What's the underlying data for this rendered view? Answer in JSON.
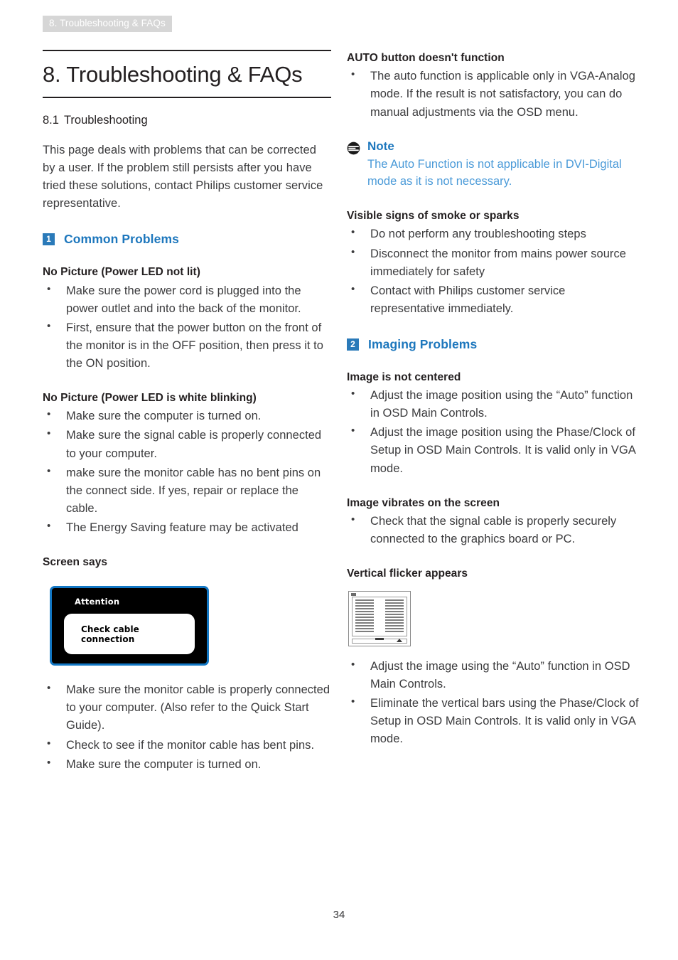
{
  "running_header": "8. Troubleshooting & FAQs",
  "chapter": {
    "title": "8. Troubleshooting & FAQs",
    "section_number": "8.1",
    "section_name": "Troubleshooting",
    "intro": "This page deals with problems that can be corrected by a user. If the problem still persists after you have tried these solutions, contact Philips customer service representative."
  },
  "colors": {
    "accent_blue": "#1d77bd",
    "badge_blue": "#2a7ab9",
    "note_body_blue": "#4a9ad8",
    "header_tab_gray": "#d6d6d6",
    "osd_border_blue": "#1277c4",
    "body_text": "#3b3b3d"
  },
  "left_column": {
    "group_1": {
      "badge": "1",
      "label": "Common Problems"
    },
    "topic_1": {
      "heading": "No Picture (Power LED not lit)",
      "bullets": [
        "Make sure the power cord is plugged into the power outlet and into the back of the monitor.",
        "First, ensure that the power button on the front of the monitor is in the OFF position, then press it to the ON position."
      ]
    },
    "topic_2": {
      "heading": "No Picture (Power LED is white blinking)",
      "bullets": [
        "Make sure the computer is turned on.",
        "Make sure the signal cable is properly connected to your computer.",
        "make sure the monitor cable has no bent pins on the connect side. If yes, repair or replace the cable.",
        "The Energy Saving feature may be activated"
      ]
    },
    "topic_3": {
      "heading": "Screen says",
      "osd_figure": {
        "title": "Attention",
        "message": "Check cable connection",
        "icon_name": "monitor-osd-attention-dialog"
      },
      "bullets": [
        "Make sure the monitor cable is properly connected to your computer. (Also refer to the Quick Start Guide).",
        "Check to see if the monitor cable has bent pins.",
        "Make sure the computer is turned on."
      ]
    }
  },
  "right_column": {
    "topic_1": {
      "heading": "AUTO button doesn't function",
      "bullets": [
        "The auto function is applicable only in VGA-Analog mode.  If the result is not satisfactory, you can do manual adjustments via the OSD menu."
      ]
    },
    "note": {
      "icon_name": "note-icon",
      "title": "Note",
      "body": "The Auto Function is not applicable in DVI-Digital mode as it is not necessary."
    },
    "topic_2": {
      "heading": "Visible signs of smoke or sparks",
      "bullets": [
        "Do not perform any troubleshooting steps",
        "Disconnect the monitor from mains power source immediately for safety",
        "Contact with Philips customer service representative immediately."
      ]
    },
    "group_2": {
      "badge": "2",
      "label": "Imaging Problems"
    },
    "topic_3": {
      "heading": "Image is not centered",
      "bullets": [
        "Adjust the image position using the “Auto” function in OSD Main Controls.",
        "Adjust the image position using the Phase/Clock of Setup in OSD Main Controls.  It is valid only in VGA mode."
      ]
    },
    "topic_4": {
      "heading": "Image vibrates on the screen",
      "bullets": [
        "Check that the signal cable is properly securely connected to the graphics board or PC."
      ]
    },
    "topic_5": {
      "heading": "Vertical flicker appears",
      "figure_icon_name": "vertical-flicker-test-pattern",
      "bullets": [
        "Adjust the image using the “Auto” function in OSD Main Controls.",
        "Eliminate the vertical bars using the Phase/Clock of Setup in OSD Main Controls. It is valid only in VGA mode."
      ]
    }
  },
  "page_number": "34"
}
